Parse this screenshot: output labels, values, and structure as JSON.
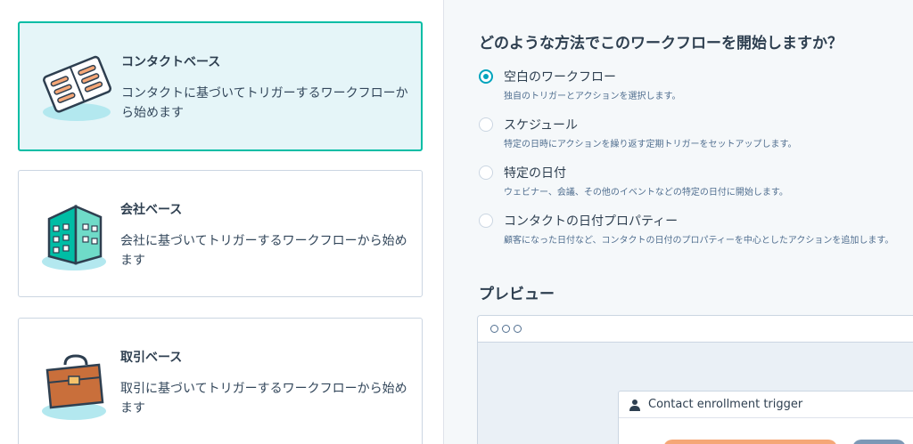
{
  "cards": [
    {
      "title": "コンタクトベース",
      "desc": "コンタクトに基づいてトリガーするワークフローから始めます",
      "icon": "contact-card-icon",
      "selected": true
    },
    {
      "title": "会社ベース",
      "desc": "会社に基づいてトリガーするワークフローから始めます",
      "icon": "building-icon",
      "selected": false
    },
    {
      "title": "取引ベース",
      "desc": "取引に基づいてトリガーするワークフローから始めます",
      "icon": "briefcase-icon",
      "selected": false
    }
  ],
  "start_question": "どのような方法でこのワークフローを開始しますか？",
  "options": [
    {
      "label": "空白のワークフロー",
      "help": "独自のトリガーとアクションを選択します。",
      "checked": true
    },
    {
      "label": "スケジュール",
      "help": "特定の日時にアクションを繰り返す定期トリガーをセットアップします。",
      "checked": false
    },
    {
      "label": "特定の日付",
      "help": "ウェビナー、会議、その他のイベントなどの特定の日付に開始します。",
      "checked": false
    },
    {
      "label": "コンタクトの日付プロパティー",
      "help": "顧客になった日付など、コンタクトの日付のプロパティーを中心としたアクションを追加します。",
      "checked": false
    }
  ],
  "preview_title": "プレビュー",
  "preview": {
    "trigger_label": "Contact enrollment trigger"
  },
  "colors": {
    "accent": "#00a4bd",
    "selected_border": "#00bda5",
    "selected_bg": "#e5f5f8",
    "heading": "#2e3f50",
    "text": "#33475b"
  }
}
